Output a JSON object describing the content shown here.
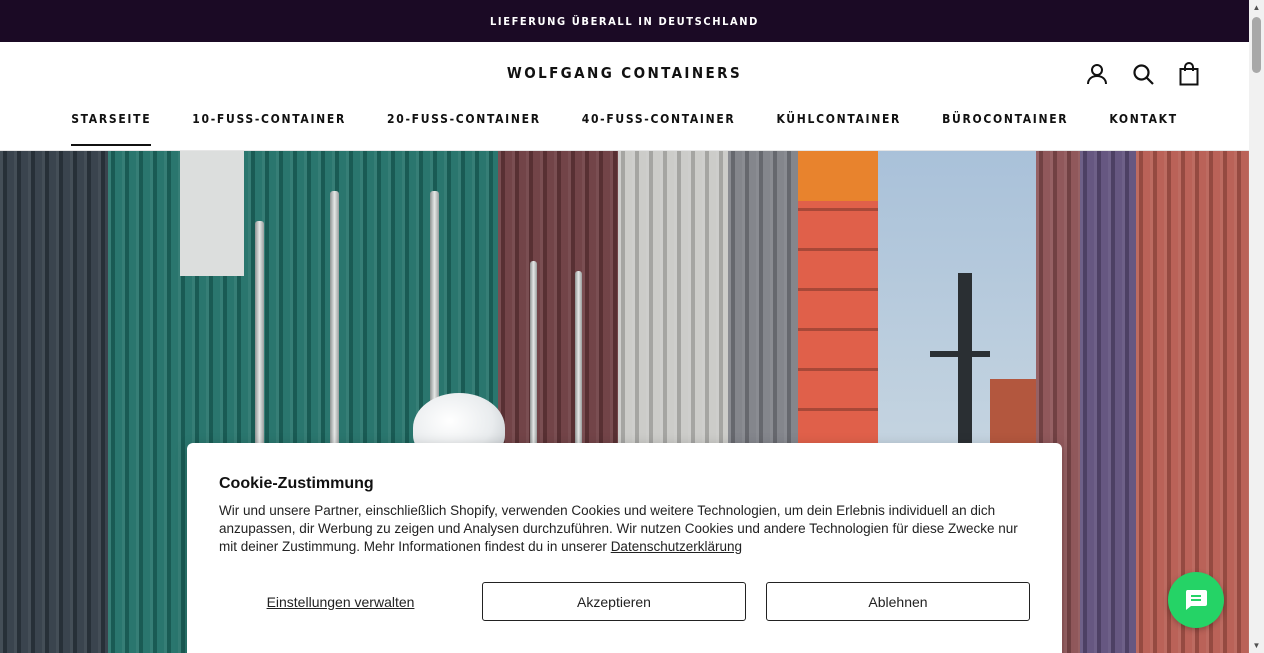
{
  "announcement": {
    "text": "LIEFERUNG ÜBERALL IN DEUTSCHLAND"
  },
  "header": {
    "logo": "WOLFGANG CONTAINERS",
    "icons": [
      "account-icon",
      "search-icon",
      "cart-icon"
    ]
  },
  "nav": {
    "items": [
      {
        "label": "STARSEITE",
        "active": true
      },
      {
        "label": "10-FUSS-CONTAINER"
      },
      {
        "label": "20-FUSS-CONTAINER"
      },
      {
        "label": "40-FUSS-CONTAINER"
      },
      {
        "label": "KÜHLCONTAINER"
      },
      {
        "label": "BÜROCONTAINER"
      },
      {
        "label": "KONTAKT"
      }
    ]
  },
  "cookie": {
    "title": "Cookie-Zustimmung",
    "text": "Wir und unsere Partner, einschließlich Shopify, verwenden Cookies und weitere Technologien, um dein Erlebnis individuell an dich anzupassen, dir Werbung zu zeigen und Analysen durchzuführen. Wir nutzen Cookies und andere Technologien für diese Zwecke nur mit deiner Zustimmung. Mehr Informationen findest du in unserer ",
    "privacy_link": "Datenschutzerklärung",
    "manage_label": "Einstellungen verwalten",
    "accept_label": "Akzeptieren",
    "decline_label": "Ablehnen"
  },
  "chat": {
    "icon": "chat-icon",
    "color": "#25d366"
  },
  "colors": {
    "announcement_bg": "#1b0a25",
    "text": "#111111"
  }
}
